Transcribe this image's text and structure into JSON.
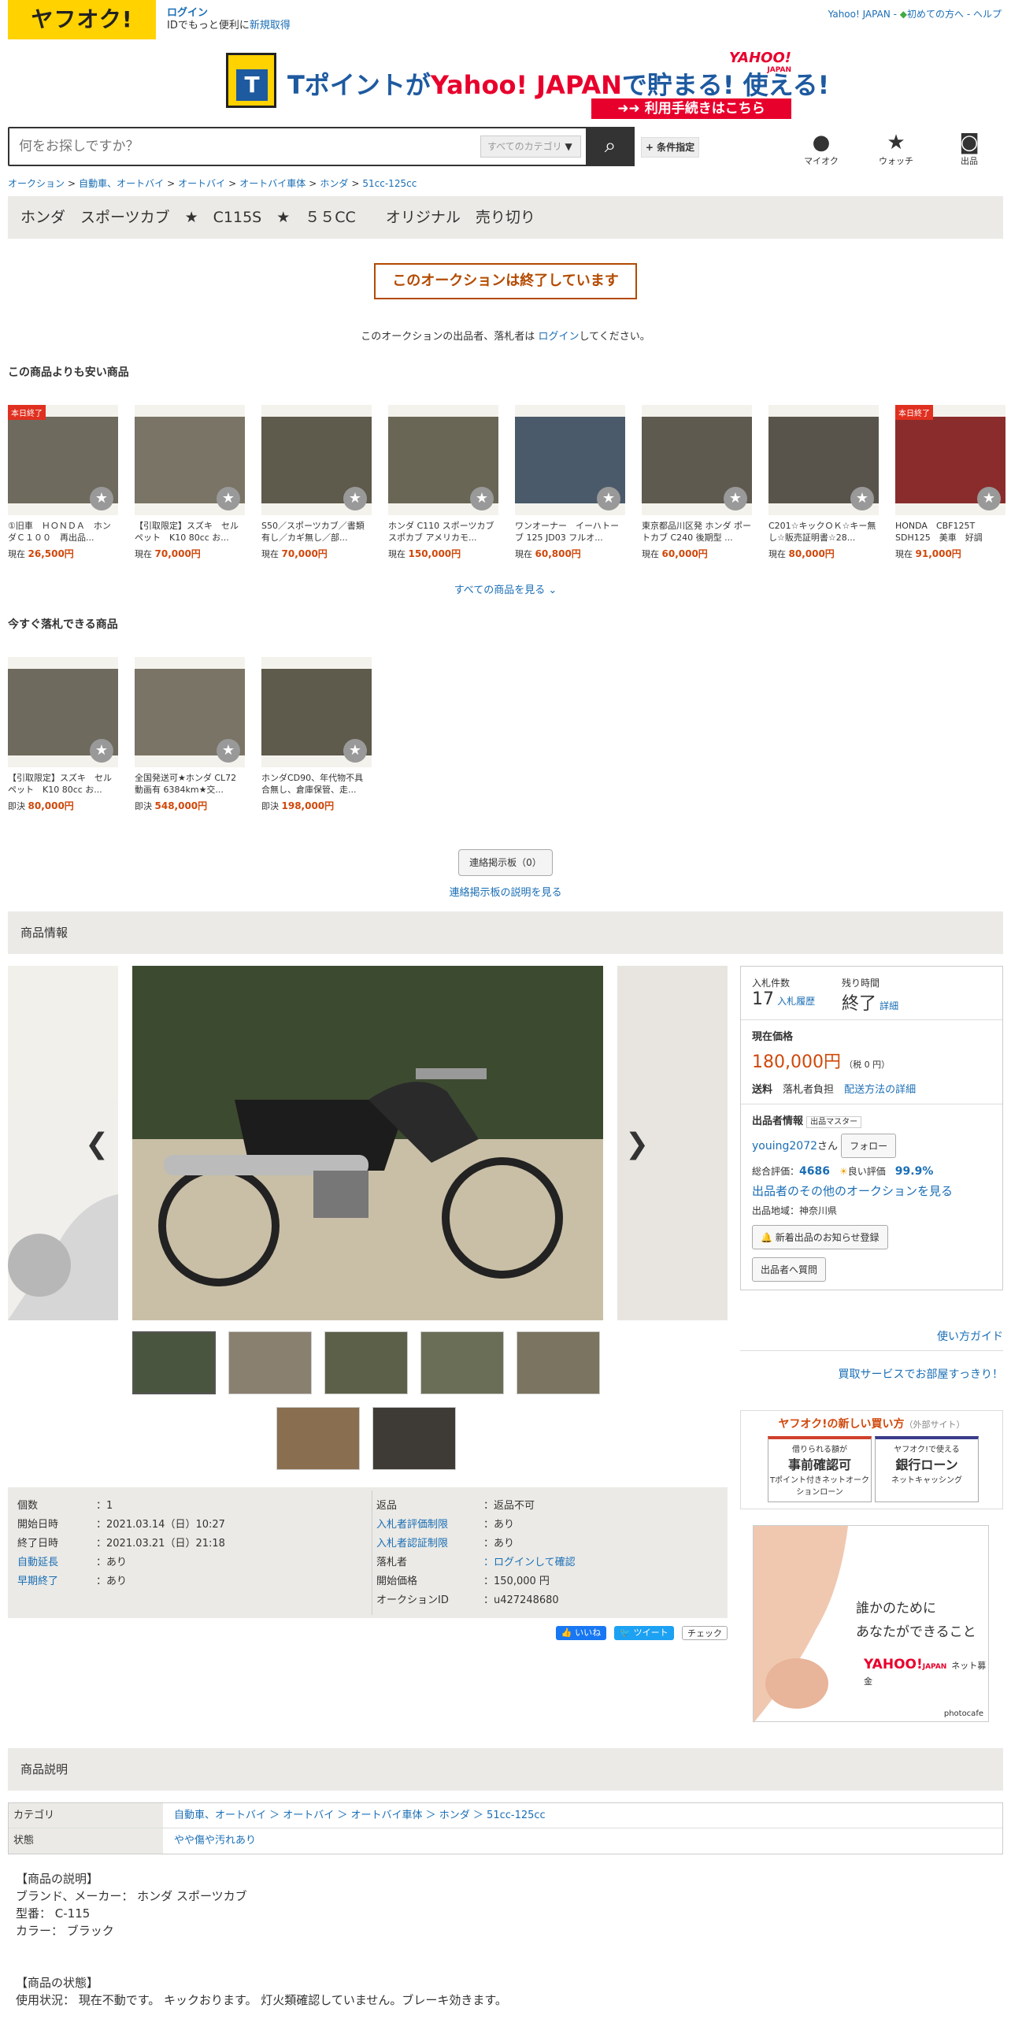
{
  "header": {
    "logo": "ヤフオク!",
    "login": "ログイン",
    "login_sub_prefix": "IDでもっと便利に",
    "login_sub_link": "新規取得",
    "links": [
      "Yahoo! JAPAN",
      "初めての方へ",
      "ヘルプ"
    ]
  },
  "banner": {
    "t_logo": "T",
    "headline_1": "Tポイントが",
    "headline_brand": "Yahoo! JAPAN",
    "headline_2": "で",
    "headline_3": "貯まる! 使える!",
    "corner": "YAHOO!",
    "corner_sub": "JAPAN",
    "button": "利用手続きはこちら"
  },
  "search": {
    "placeholder": "何をお探しですか？",
    "category": "すべてのカテゴリ",
    "condition_button": "+ 条件指定"
  },
  "nav_icons": [
    {
      "label": "マイオク",
      "icon": "user-icon"
    },
    {
      "label": "ウォッチ",
      "icon": "star-icon"
    },
    {
      "label": "出品",
      "icon": "camera-icon"
    }
  ],
  "breadcrumb": [
    "オークション",
    "自動車、オートバイ",
    "オートバイ",
    "オートバイ車体",
    "ホンダ",
    "51cc-125cc"
  ],
  "title": "ホンダ　スポーツカブ　★　C115S　★　５５CC　　オリジナル　売り切り",
  "ended_notice": "このオークションは終了しています",
  "login_msg_prefix": "このオークションの出品者、落札者は",
  "login_msg_link": "ログイン",
  "login_msg_suffix": "してください。",
  "cheaper": {
    "heading": "この商品よりも安い商品",
    "items": [
      {
        "tag": "本日終了",
        "title": "①旧車　ＨＯＮＤＡ　ホンダＣ１００　再出品...",
        "price_label": "現在",
        "price": "26,500円"
      },
      {
        "tag": "",
        "title": "【引取限定】スズキ　セルペット　K10 80cc お...",
        "price_label": "現在",
        "price": "70,000円"
      },
      {
        "tag": "",
        "title": "S50／スポーツカブ／書類有し／カギ無し／部...",
        "price_label": "現在",
        "price": "70,000円"
      },
      {
        "tag": "",
        "title": "ホンダ C110 スポーツカブ スポカブ アメリカモ...",
        "price_label": "現在",
        "price": "150,000円"
      },
      {
        "tag": "",
        "title": "ワンオーナー　イーハトーブ 125 JD03 フルオ...",
        "price_label": "現在",
        "price": "60,800円"
      },
      {
        "tag": "",
        "title": "東京都品川区発 ホンダ ポートカブ C240 後期型 ...",
        "price_label": "現在",
        "price": "60,000円"
      },
      {
        "tag": "",
        "title": "C201☆キックＯＫ☆キー無し☆販売証明書☆28...",
        "price_label": "現在",
        "price": "80,000円"
      },
      {
        "tag": "本日終了",
        "title": "HONDA　CBF125T　SDH125　美車　好調　走...",
        "price_label": "現在",
        "price": "91,000円"
      }
    ],
    "see_all": "すべての商品を見る"
  },
  "buynow": {
    "heading": "今すぐ落札できる商品",
    "items": [
      {
        "title": "【引取限定】スズキ　セルペット　K10 80cc お...",
        "price_label": "即決",
        "price": "80,000円"
      },
      {
        "title": "全国発送可★ホンダ CL72 動画有 6384km★交...",
        "price_label": "即決",
        "price": "548,000円"
      },
      {
        "title": "ホンダCD90、年代物不具合無し、倉庫保管、走...",
        "price_label": "即決",
        "price": "198,000円"
      }
    ]
  },
  "board": {
    "button": "連絡掲示板（0）",
    "link": "連絡掲示板の説明を見る"
  },
  "product_info_heading": "商品情報",
  "side": {
    "bids_label": "入札件数",
    "bids": "17",
    "bids_link": "入札履歴",
    "remain_label": "残り時間",
    "remain": "終了",
    "remain_link": "詳細",
    "price_label": "現在価格",
    "price": "180,000円",
    "tax": "（税 0 円）",
    "ship_label": "送料",
    "ship_value": "落札者負担",
    "ship_link": "配送方法の詳細",
    "seller_heading": "出品者情報",
    "seller_badge": "出品マスター",
    "seller_name": "youing2072",
    "seller_suffix": "さん",
    "follow": "フォロー",
    "rating_label": "総合評価：",
    "rating": "4686",
    "good_label": "良い評価",
    "good": "99.9%",
    "other_auctions": "出品者のその他のオークションを見る",
    "region": "出品地域：神奈川県",
    "notify_btn": "新着出品のお知らせ登録",
    "question_btn": "出品者へ質問"
  },
  "guide_link": "使い方ガイド",
  "buy_service_link": "買取サービスでお部屋すっきり！",
  "new_buy": {
    "title": "ヤフオク!の新しい買い方",
    "ext": "（外部サイト）",
    "card1_top": "借りられる額が",
    "card1_main": "事前確認可",
    "card1_sub": "Tポイント付きネットオークションローン",
    "card2_top": "ヤフオク!で使える",
    "card2_main": "銀行ローン",
    "card2_sub": "ネットキャッシング"
  },
  "ad": {
    "line1": "誰かのために",
    "line2": "あなたができること",
    "brand": "YAHOO!",
    "brand_sub": "JAPAN",
    "brand_tail": "ネット募金",
    "credit": "photocafe"
  },
  "info_left": [
    {
      "k": "個数",
      "v": "1",
      "link": false
    },
    {
      "k": "開始日時",
      "v": "2021.03.14（日）10:27",
      "link": false
    },
    {
      "k": "終了日時",
      "v": "2021.03.21（日）21:18",
      "link": false
    },
    {
      "k": "自動延長",
      "v": "あり",
      "link": true
    },
    {
      "k": "早期終了",
      "v": "あり",
      "link": true
    }
  ],
  "info_right": [
    {
      "k": "返品",
      "v": "返品不可",
      "link": false,
      "vlink": false
    },
    {
      "k": "入札者評価制限",
      "v": "あり",
      "link": true,
      "vlink": false
    },
    {
      "k": "入札者認証制限",
      "v": "あり",
      "link": true,
      "vlink": false
    },
    {
      "k": "落札者",
      "v": "ログインして確認",
      "link": false,
      "vlink": true
    },
    {
      "k": "開始価格",
      "v": "150,000 円",
      "link": false,
      "vlink": false
    },
    {
      "k": "オークションID",
      "v": "u427248680",
      "link": false,
      "vlink": false
    }
  ],
  "social": {
    "like": "いいね",
    "tweet": "ツイート",
    "check": "チェック"
  },
  "desc_heading": "商品説明",
  "desc_table": [
    {
      "k": "カテゴリ",
      "v": "自動車、オートバイ ＞ オートバイ ＞ オートバイ車体 ＞ ホンダ ＞ 51cc-125cc"
    },
    {
      "k": "状態",
      "v": "やや傷や汚れあり"
    }
  ],
  "desc_body": "【商品の説明】\nブランド、メーカー： ホンダ スポーツカブ\n型番： C-115\nカラー： ブラック\n\n\n【商品の状態】\n使用状況： 現在不動です。 キックおります。 灯火類確認していません。ブレーキ効きます。",
  "colors": {
    "yahoo_yellow": "#ffd200",
    "price_orange": "#d0480b",
    "link_blue": "#1a6eb5",
    "ended_brown": "#b34a00",
    "bar_gray": "#ebeae6"
  }
}
